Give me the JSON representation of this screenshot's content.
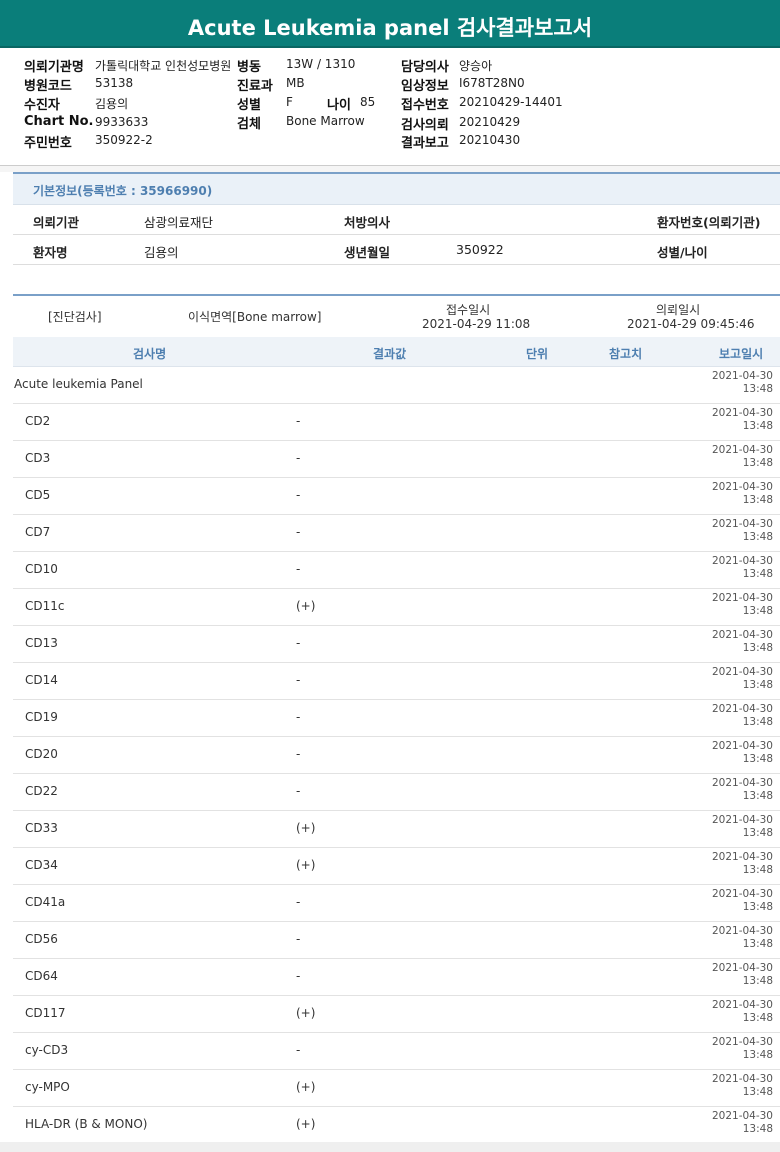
{
  "title": "Acute Leukemia panel 검사결과보고서",
  "header": {
    "left": [
      {
        "label": "의뢰기관명",
        "value": "가톨릭대학교 인천성모병원"
      },
      {
        "label": "병원코드",
        "value": "53138"
      },
      {
        "label": "수진자",
        "value": "김용의"
      },
      {
        "label": "Chart No.",
        "value": "9933633"
      },
      {
        "label": "주민번호",
        "value": "350922-2"
      }
    ],
    "middle": {
      "ward_label": "병동",
      "ward_value": "13W / 1310",
      "dept_label": "진료과",
      "dept_value": "MB",
      "sex_label": "성별",
      "sex_value": "F",
      "age_label": "나이",
      "age_value": "85",
      "specimen_label": "검체",
      "specimen_value": "Bone Marrow"
    },
    "right": [
      {
        "label": "담당의사",
        "value": "양승아"
      },
      {
        "label": "임상정보",
        "value": "I678T28N0"
      },
      {
        "label": "접수번호",
        "value": "20210429-14401"
      },
      {
        "label": "검사의뢰",
        "value": "20210429"
      },
      {
        "label": "결과보고",
        "value": "20210430"
      }
    ]
  },
  "basic_info": {
    "heading": "기본정보(등록번호 : 35966990)",
    "requester_label": "의뢰기관",
    "requester_value": "삼광의료재단",
    "doctor_label": "처방의사",
    "patient_no_label": "환자번호(의뢰기관)",
    "patient_label": "환자명",
    "patient_value": "김용의",
    "birth_label": "생년월일",
    "birth_value": "350922",
    "sexage_label": "성별/나이"
  },
  "exam": {
    "category": "[진단검사]",
    "specimen": "이식면역[Bone marrow]",
    "receipt_label": "접수일시",
    "receipt_value": "2021-04-29  11:08",
    "request_label": "의뢰일시",
    "request_value": "2021-04-29  09:45:46"
  },
  "columns": {
    "name": "검사명",
    "result": "결과값",
    "unit": "단위",
    "reference": "참고치",
    "report_date": "보고일시"
  },
  "results": [
    {
      "name": "Acute leukemia Panel",
      "result": "",
      "date": "2021-04-30",
      "time": "13:48",
      "indent": false
    },
    {
      "name": "CD2",
      "result": "-",
      "date": "2021-04-30",
      "time": "13:48",
      "indent": true
    },
    {
      "name": "CD3",
      "result": "-",
      "date": "2021-04-30",
      "time": "13:48",
      "indent": true
    },
    {
      "name": "CD5",
      "result": "-",
      "date": "2021-04-30",
      "time": "13:48",
      "indent": true
    },
    {
      "name": "CD7",
      "result": "-",
      "date": "2021-04-30",
      "time": "13:48",
      "indent": true
    },
    {
      "name": "CD10",
      "result": "-",
      "date": "2021-04-30",
      "time": "13:48",
      "indent": true
    },
    {
      "name": "CD11c",
      "result": "(+)",
      "date": "2021-04-30",
      "time": "13:48",
      "indent": true
    },
    {
      "name": "CD13",
      "result": "-",
      "date": "2021-04-30",
      "time": "13:48",
      "indent": true
    },
    {
      "name": "CD14",
      "result": "-",
      "date": "2021-04-30",
      "time": "13:48",
      "indent": true
    },
    {
      "name": "CD19",
      "result": "-",
      "date": "2021-04-30",
      "time": "13:48",
      "indent": true
    },
    {
      "name": "CD20",
      "result": "-",
      "date": "2021-04-30",
      "time": "13:48",
      "indent": true
    },
    {
      "name": "CD22",
      "result": "-",
      "date": "2021-04-30",
      "time": "13:48",
      "indent": true
    },
    {
      "name": "CD33",
      "result": "(+)",
      "date": "2021-04-30",
      "time": "13:48",
      "indent": true
    },
    {
      "name": "CD34",
      "result": "(+)",
      "date": "2021-04-30",
      "time": "13:48",
      "indent": true
    },
    {
      "name": "CD41a",
      "result": "-",
      "date": "2021-04-30",
      "time": "13:48",
      "indent": true
    },
    {
      "name": "CD56",
      "result": "-",
      "date": "2021-04-30",
      "time": "13:48",
      "indent": true
    },
    {
      "name": "CD64",
      "result": "-",
      "date": "2021-04-30",
      "time": "13:48",
      "indent": true
    },
    {
      "name": "CD117",
      "result": "(+)",
      "date": "2021-04-30",
      "time": "13:48",
      "indent": true
    },
    {
      "name": "cy-CD3",
      "result": "-",
      "date": "2021-04-30",
      "time": "13:48",
      "indent": true
    },
    {
      "name": "cy-MPO",
      "result": "(+)",
      "date": "2021-04-30",
      "time": "13:48",
      "indent": true
    },
    {
      "name": "HLA-DR (B & MONO)",
      "result": "(+)",
      "date": "2021-04-30",
      "time": "13:48",
      "indent": true
    }
  ]
}
